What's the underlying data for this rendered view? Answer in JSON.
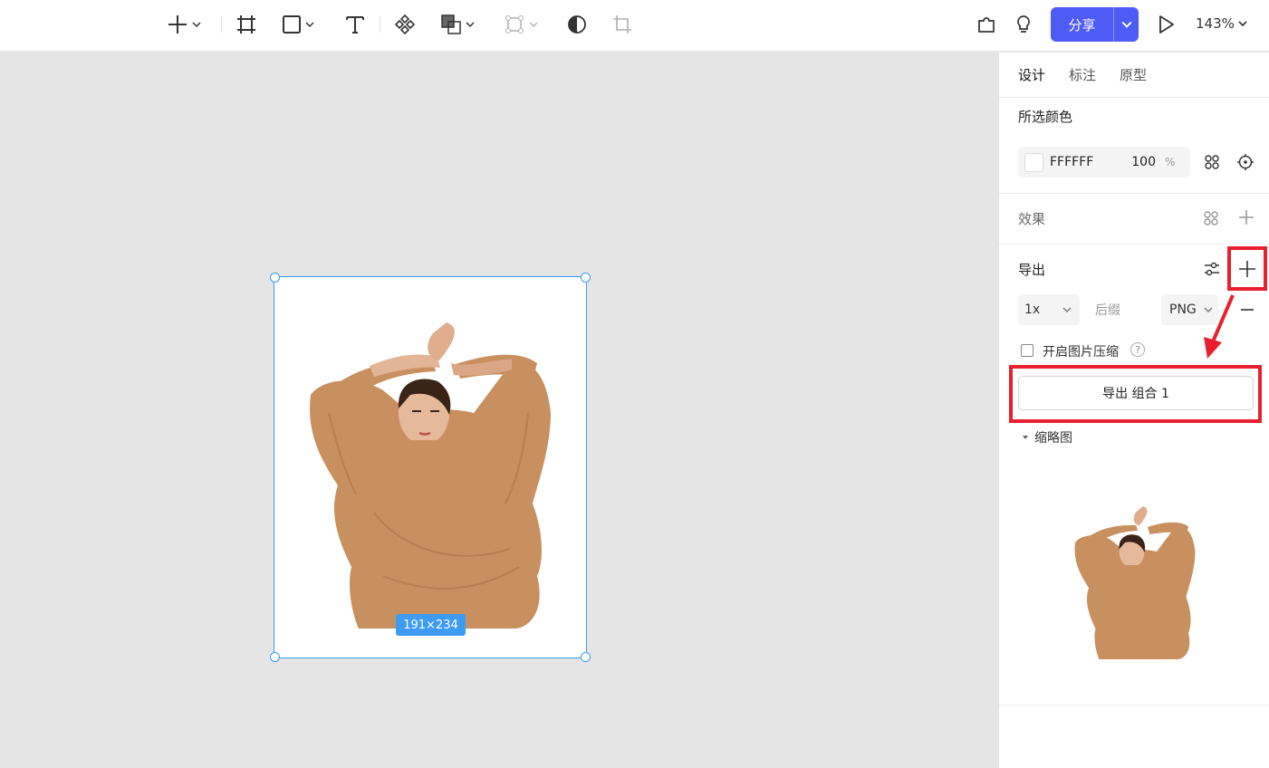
{
  "toolbar": {
    "tools": [
      "add-icon",
      "frame-icon",
      "rectangle-icon",
      "text-icon",
      "component-icon",
      "boolean-icon",
      "path-icon",
      "mask-icon",
      "crop-icon"
    ],
    "share_label": "分享",
    "zoom_label": "143%"
  },
  "canvas": {
    "size_badge": "191×234"
  },
  "panel": {
    "tabs": [
      {
        "label": "设计",
        "active": true
      },
      {
        "label": "标注",
        "active": false
      },
      {
        "label": "原型",
        "active": false
      }
    ],
    "selected_color": {
      "title": "所选颜色",
      "hex": "FFFFFF",
      "opacity": "100",
      "percent": "%"
    },
    "effects": {
      "title": "效果"
    },
    "export": {
      "title": "导出",
      "scale": "1x",
      "suffix_placeholder": "后缀",
      "format": "PNG",
      "compress_label": "开启图片压缩",
      "help_glyph": "?",
      "button_label": "导出 组合 1"
    },
    "thumbnail": {
      "title": "缩略图"
    }
  },
  "colors": {
    "accent": "#4f5bf5",
    "selection": "#3d9bf3",
    "highlight": "#e8202e",
    "sweater": "#c8905f"
  }
}
